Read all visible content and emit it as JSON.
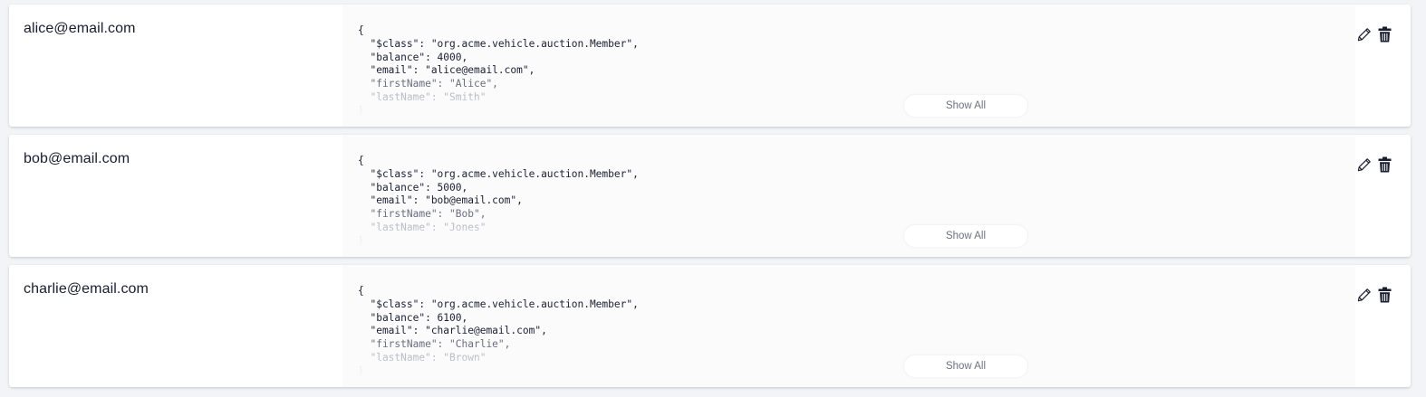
{
  "participants": [
    {
      "id": "alice@email.com",
      "json_lines": [
        "{",
        "  \"$class\": \"org.acme.vehicle.auction.Member\",",
        "  \"balance\": 4000,",
        "  \"email\": \"alice@email.com\",",
        "  \"firstName\": \"Alice\",",
        "  \"lastName\": \"Smith\"",
        "}"
      ],
      "show_all_label": "Show All",
      "edit_icon": "pencil-icon",
      "delete_icon": "trash-icon"
    },
    {
      "id": "bob@email.com",
      "json_lines": [
        "{",
        "  \"$class\": \"org.acme.vehicle.auction.Member\",",
        "  \"balance\": 5000,",
        "  \"email\": \"bob@email.com\",",
        "  \"firstName\": \"Bob\",",
        "  \"lastName\": \"Jones\"",
        "}"
      ],
      "show_all_label": "Show All",
      "edit_icon": "pencil-icon",
      "delete_icon": "trash-icon"
    },
    {
      "id": "charlie@email.com",
      "json_lines": [
        "{",
        "  \"$class\": \"org.acme.vehicle.auction.Member\",",
        "  \"balance\": 6100,",
        "  \"email\": \"charlie@email.com\",",
        "  \"firstName\": \"Charlie\",",
        "  \"lastName\": \"Brown\"",
        "}"
      ],
      "show_all_label": "Show All",
      "edit_icon": "pencil-icon",
      "delete_icon": "trash-icon"
    }
  ],
  "colors": {
    "background": "#f3f4f8",
    "card": "#ffffff",
    "text": "#1a1d30",
    "muted": "#6d7080"
  }
}
